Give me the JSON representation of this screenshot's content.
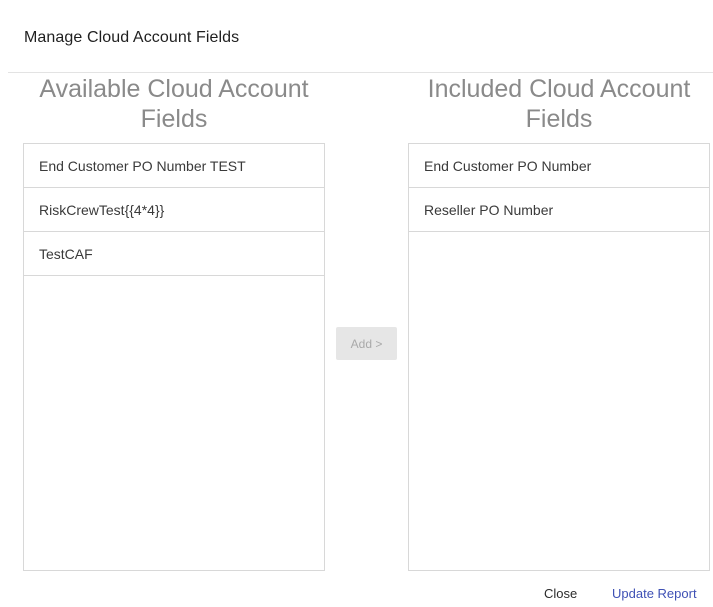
{
  "dialog": {
    "title": "Manage Cloud Account Fields"
  },
  "available": {
    "heading_line1": "Available Cloud Account",
    "heading_line2": "Fields",
    "items": [
      "End Customer PO Number TEST",
      "RiskCrewTest{{4*4}}",
      "TestCAF"
    ]
  },
  "included": {
    "heading_line1": "Included Cloud Account",
    "heading_line2": "Fields",
    "items": [
      "End Customer PO Number",
      "Reseller PO Number"
    ]
  },
  "actions": {
    "add_label": "Add >",
    "add_disabled": true,
    "close_label": "Close",
    "update_label": "Update Report"
  },
  "colors": {
    "accent": "#3f51b5",
    "heading_gray": "#8a8a8a",
    "border": "#d8d8d8",
    "disabled_bg": "#e6e6e6"
  }
}
